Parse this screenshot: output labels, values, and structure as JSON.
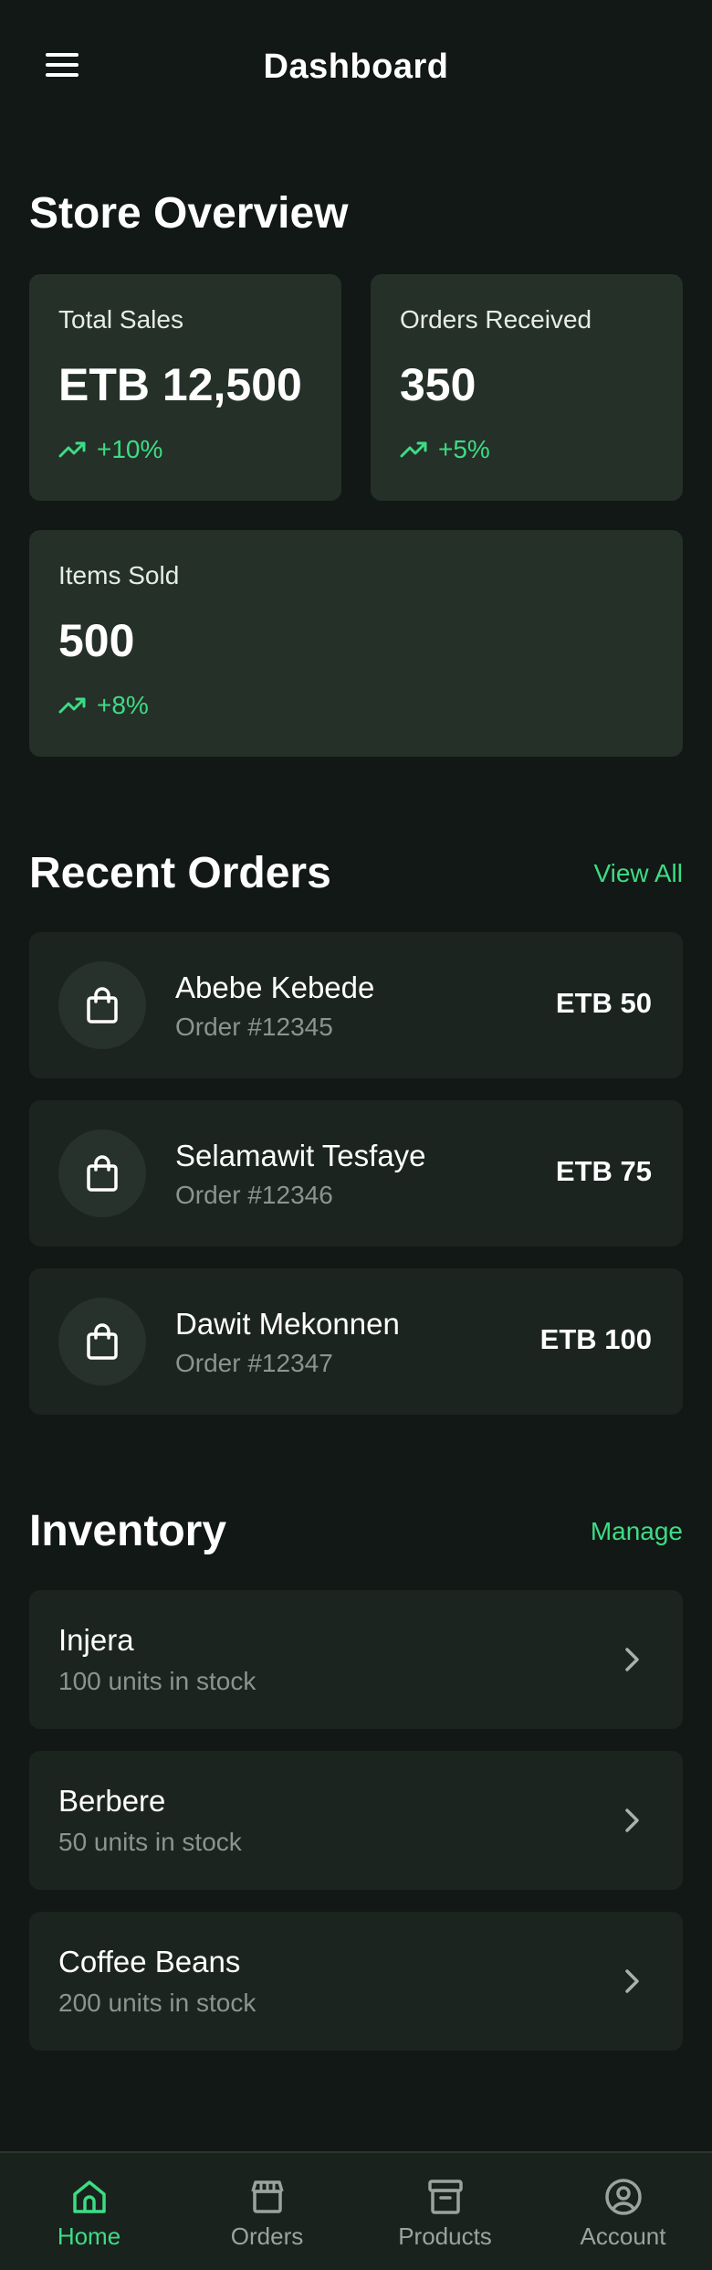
{
  "header": {
    "title": "Dashboard",
    "menu_icon": "hamburger-menu-icon"
  },
  "overview": {
    "title": "Store Overview",
    "stats": [
      {
        "label": "Total Sales",
        "value": "ETB 12,500",
        "trend": "+10%",
        "trend_icon": "trending-up-icon"
      },
      {
        "label": "Orders Received",
        "value": "350",
        "trend": "+5%",
        "trend_icon": "trending-up-icon"
      },
      {
        "label": "Items Sold",
        "value": "500",
        "trend": "+8%",
        "trend_icon": "trending-up-icon"
      }
    ]
  },
  "recent_orders": {
    "title": "Recent Orders",
    "link": "View All",
    "items": [
      {
        "name": "Abebe Kebede",
        "order": "Order #12345",
        "amount": "ETB 50",
        "icon": "shopping-bag-icon"
      },
      {
        "name": "Selamawit Tesfaye",
        "order": "Order #12346",
        "amount": "ETB 75",
        "icon": "shopping-bag-icon"
      },
      {
        "name": "Dawit Mekonnen",
        "order": "Order #12347",
        "amount": "ETB 100",
        "icon": "shopping-bag-icon"
      }
    ]
  },
  "inventory": {
    "title": "Inventory",
    "link": "Manage",
    "items": [
      {
        "name": "Injera",
        "stock": "100 units in stock"
      },
      {
        "name": "Berbere",
        "stock": "50 units in stock"
      },
      {
        "name": "Coffee Beans",
        "stock": "200 units in stock"
      }
    ]
  },
  "nav": {
    "items": [
      {
        "label": "Home",
        "icon": "home-icon",
        "active": true
      },
      {
        "label": "Orders",
        "icon": "storefront-icon",
        "active": false
      },
      {
        "label": "Products",
        "icon": "archive-box-icon",
        "active": false
      },
      {
        "label": "Account",
        "icon": "user-circle-icon",
        "active": false
      }
    ]
  },
  "colors": {
    "background": "#121816",
    "card": "#253029",
    "list_card": "#1c2420",
    "accent": "#3ddc84",
    "muted_text": "#8b948f"
  }
}
